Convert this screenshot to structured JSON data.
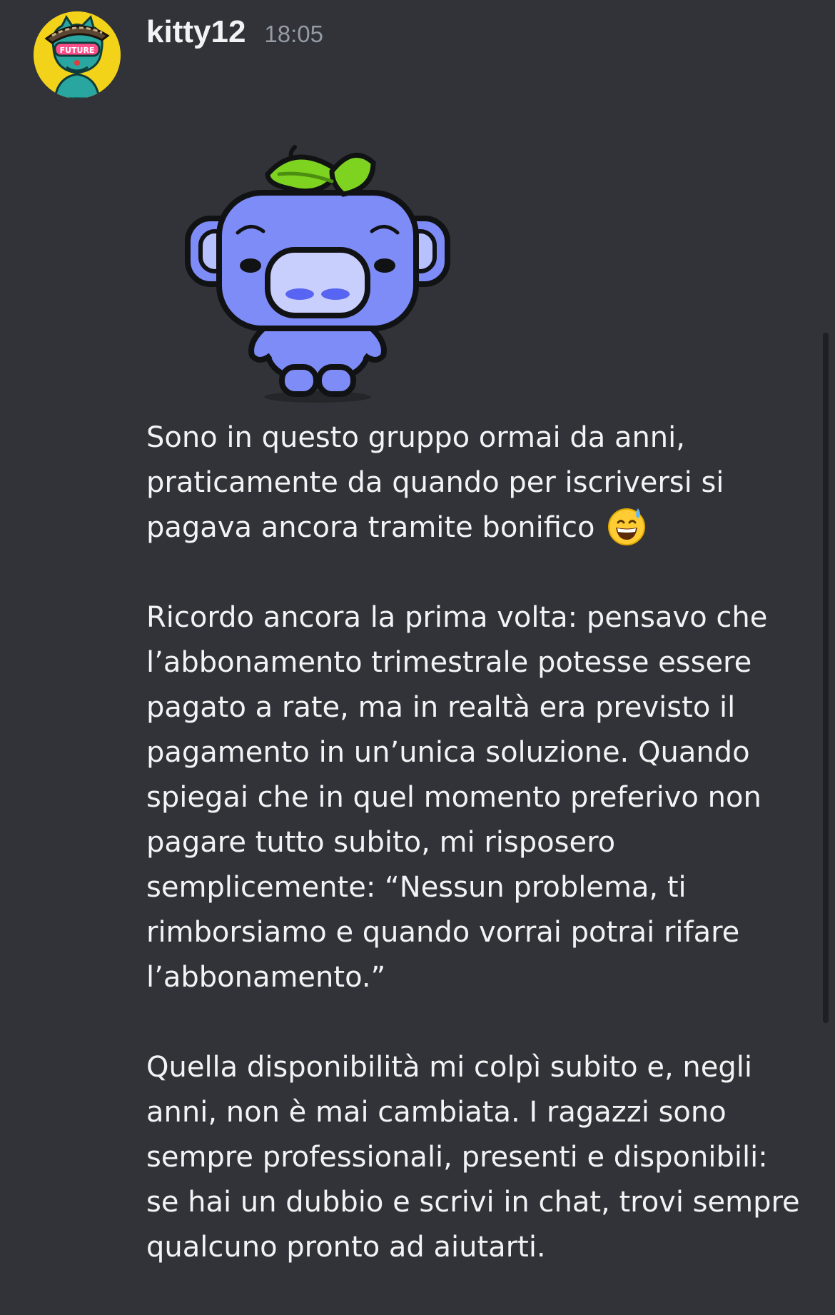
{
  "message": {
    "author": "kitty12",
    "timestamp": "18:05",
    "avatar_icon": "punk-cat-avatar",
    "sticker_icon": "wumpus-leaf-sticker",
    "emoji": "grinning-face-with-sweat",
    "paragraphs": [
      {
        "lines": [
          "Sono in questo gruppo ormai da anni,",
          "praticamente da quando per iscriversi si",
          "pagava ancora tramite bonifico"
        ]
      },
      {
        "lines": [
          "Ricordo ancora la prima volta: pensavo che",
          "l’abbonamento trimestrale potesse essere",
          "pagato a rate, ma in realtà era previsto il",
          "pagamento in un’unica soluzione. Quando",
          "spiegai che in quel momento preferivo non",
          "pagare tutto subito, mi risposero",
          "semplicemente: “Nessun problema, ti",
          "rimborsiamo e quando vorrai potrai rifare",
          "l’abbonamento.”"
        ]
      },
      {
        "lines": [
          "Quella disponibilità mi colpì subito e, negli",
          "anni, non è mai cambiata. I ragazzi sono",
          "sempre professionali, presenti e disponibili:",
          "se hai un dubbio e scrivi in chat, trovi sempre",
          "qualcuno pronto ad aiutarti."
        ]
      }
    ]
  },
  "colors": {
    "background": "#313338",
    "text": "#f2f3f5",
    "timestamp": "#949ba4",
    "wumpus": "#7e8cf7",
    "leaf": "#7ed321",
    "avatar_bg": "#f3d31a"
  }
}
